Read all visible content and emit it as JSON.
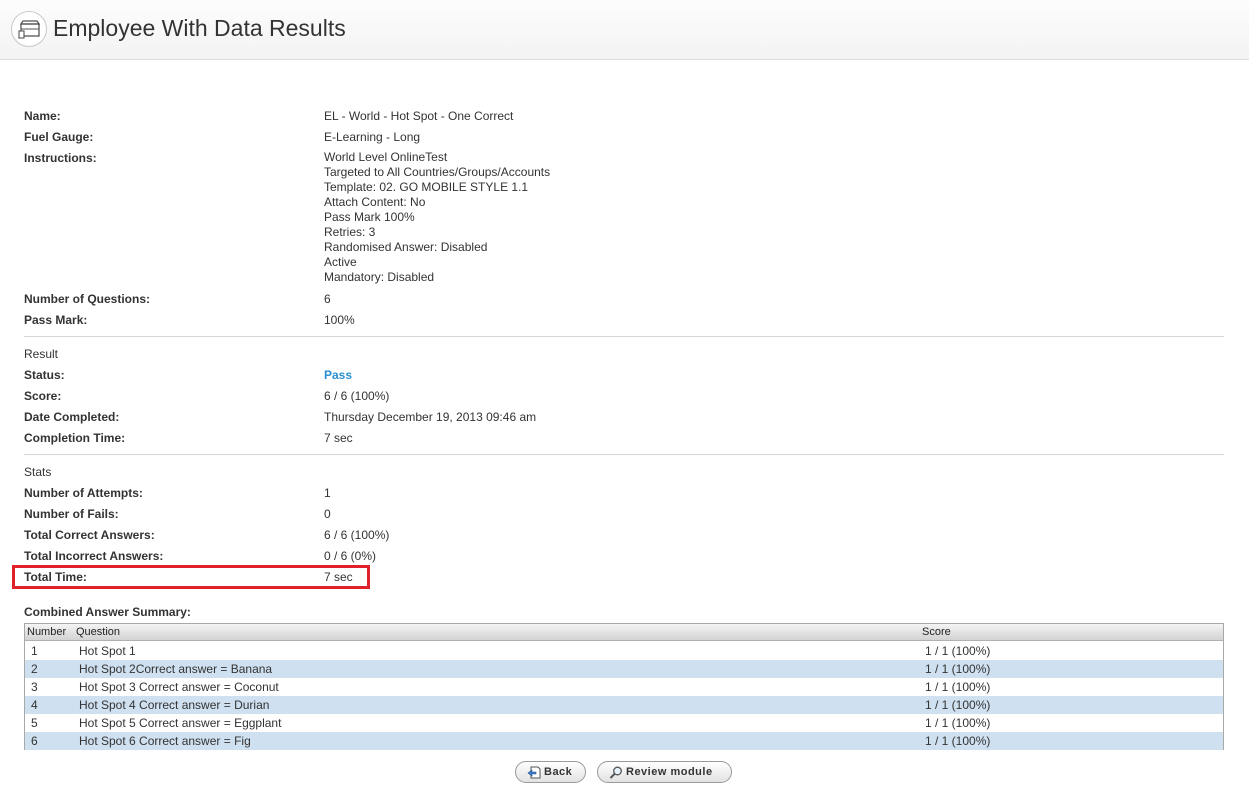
{
  "header": {
    "title": "Employee With Data Results",
    "icon": "test-module-icon"
  },
  "details": {
    "name_label": "Name:",
    "name_value": "EL - World - Hot Spot - One Correct",
    "fuel_label": "Fuel Gauge:",
    "fuel_value": "E-Learning - Long",
    "instructions_label": "Instructions:",
    "instructions_lines": [
      "World Level OnlineTest",
      "Targeted to All Countries/Groups/Accounts",
      "Template: 02. GO MOBILE STYLE 1.1",
      "Attach Content: No",
      "Pass Mark 100%",
      "Retries: 3",
      "Randomised Answer: Disabled",
      "Active",
      "Mandatory: Disabled"
    ],
    "questions_label": "Number of Questions:",
    "questions_value": "6",
    "passmark_label": "Pass Mark:",
    "passmark_value": "100%"
  },
  "result": {
    "heading": "Result",
    "status_label": "Status:",
    "status_value": "Pass",
    "score_label": "Score:",
    "score_value": "6 / 6 (100%)",
    "date_label": "Date Completed:",
    "date_value": "Thursday December 19, 2013 09:46 am",
    "completion_label": "Completion Time:",
    "completion_value": "7 sec"
  },
  "stats": {
    "heading": "Stats",
    "attempts_label": "Number of Attempts:",
    "attempts_value": "1",
    "fails_label": "Number of Fails:",
    "fails_value": "0",
    "correct_label": "Total Correct Answers:",
    "correct_value": "6 / 6 (100%)",
    "incorrect_label": "Total Incorrect Answers:",
    "incorrect_value": "0 / 6 (0%)",
    "time_label": "Total Time:",
    "time_value": "7 sec"
  },
  "summary": {
    "title": "Combined Answer Summary:",
    "columns": [
      "Number",
      "Question",
      "Score"
    ],
    "rows": [
      {
        "number": "1",
        "question": "Hot Spot 1",
        "score": "1 / 1 (100%)"
      },
      {
        "number": "2",
        "question": "Hot Spot 2Correct answer = Banana",
        "score": "1 / 1 (100%)"
      },
      {
        "number": "3",
        "question": "Hot Spot 3 Correct answer = Coconut",
        "score": "1 / 1 (100%)"
      },
      {
        "number": "4",
        "question": "Hot Spot 4 Correct answer = Durian",
        "score": "1 / 1 (100%)"
      },
      {
        "number": "5",
        "question": "Hot Spot 5 Correct answer = Eggplant",
        "score": "1 / 1 (100%)"
      },
      {
        "number": "6",
        "question": "Hot Spot 6 Correct answer = Fig",
        "score": "1 / 1 (100%)"
      }
    ]
  },
  "actions": {
    "back_label": "Back",
    "back_icon": "back-page-icon",
    "review_label": "Review module",
    "review_icon": "magnifier-icon"
  },
  "colors": {
    "pass": "#2a8fd1",
    "row_alt": "#cfe0f0",
    "highlight": "#e0202a"
  }
}
